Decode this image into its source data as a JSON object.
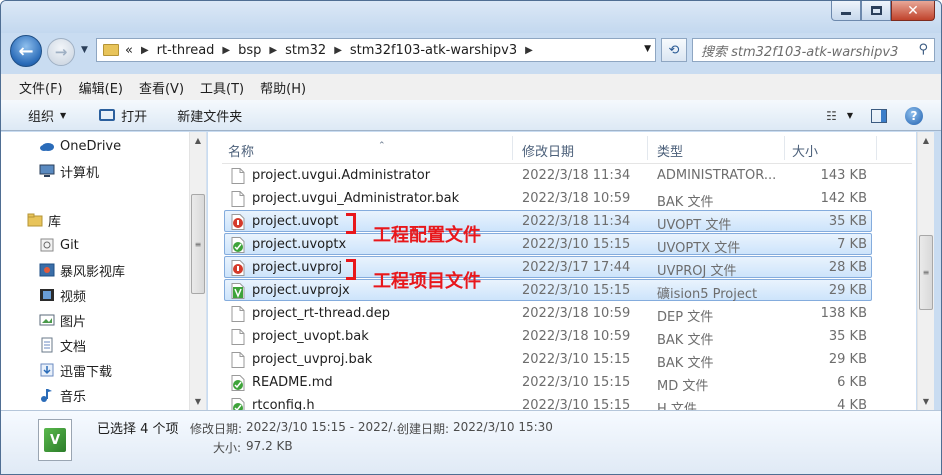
{
  "window": {
    "minimize": "–",
    "maximize": "□",
    "close": "✕"
  },
  "address": {
    "prefix": "«",
    "crumbs": [
      "rt-thread",
      "bsp",
      "stm32",
      "stm32f103-atk-warshipv3"
    ],
    "search_placeholder": "搜索 stm32f103-atk-warshipv3"
  },
  "menu": [
    "文件(F)",
    "编辑(E)",
    "查看(V)",
    "工具(T)",
    "帮助(H)"
  ],
  "toolbar": {
    "organize": "组织",
    "open": "打开",
    "new_folder": "新建文件夹"
  },
  "nav": [
    {
      "label": "OneDrive",
      "icon": "cloud-icon"
    },
    {
      "label": "计算机",
      "icon": "computer-icon"
    },
    {
      "label": "库",
      "icon": "library-icon"
    },
    {
      "label": "Git",
      "icon": "git-icon"
    },
    {
      "label": "暴风影视库",
      "icon": "video-library-icon"
    },
    {
      "label": "视频",
      "icon": "video-icon"
    },
    {
      "label": "图片",
      "icon": "picture-icon"
    },
    {
      "label": "文档",
      "icon": "document-icon"
    },
    {
      "label": "迅雷下载",
      "icon": "download-icon"
    },
    {
      "label": "音乐",
      "icon": "music-icon"
    }
  ],
  "columns": {
    "name": "名称",
    "date": "修改日期",
    "type": "类型",
    "size": "大小"
  },
  "files": [
    {
      "name": "project.uvgui.Administrator",
      "date": "2022/3/18 11:34",
      "type": "ADMINISTRATOR...",
      "size": "143 KB",
      "icon": "file-icon",
      "selected": false
    },
    {
      "name": "project.uvgui_Administrator.bak",
      "date": "2022/3/18 10:59",
      "type": "BAK 文件",
      "size": "142 KB",
      "icon": "file-icon",
      "selected": false
    },
    {
      "name": "project.uvopt",
      "date": "2022/3/18 11:34",
      "type": "UVOPT 文件",
      "size": "35 KB",
      "icon": "keil-red-icon",
      "selected": true
    },
    {
      "name": "project.uvoptx",
      "date": "2022/3/10 15:15",
      "type": "UVOPTX 文件",
      "size": "7 KB",
      "icon": "keil-green-icon",
      "selected": true
    },
    {
      "name": "project.uvproj",
      "date": "2022/3/17 17:44",
      "type": "UVPROJ 文件",
      "size": "28 KB",
      "icon": "keil-red-icon",
      "selected": true
    },
    {
      "name": "project.uvprojx",
      "date": "2022/3/10 15:15",
      "type": "礦ision5 Project",
      "size": "29 KB",
      "icon": "keil-project-icon",
      "selected": true
    },
    {
      "name": "project_rt-thread.dep",
      "date": "2022/3/18 10:59",
      "type": "DEP 文件",
      "size": "138 KB",
      "icon": "file-icon",
      "selected": false
    },
    {
      "name": "project_uvopt.bak",
      "date": "2022/3/18 10:59",
      "type": "BAK 文件",
      "size": "35 KB",
      "icon": "file-icon",
      "selected": false
    },
    {
      "name": "project_uvproj.bak",
      "date": "2022/3/10 15:15",
      "type": "BAK 文件",
      "size": "29 KB",
      "icon": "file-icon",
      "selected": false
    },
    {
      "name": "README.md",
      "date": "2022/3/10 15:15",
      "type": "MD 文件",
      "size": "6 KB",
      "icon": "keil-green-icon",
      "selected": false
    },
    {
      "name": "rtconfig.h",
      "date": "2022/3/10 15:15",
      "type": "H 文件",
      "size": "4 KB",
      "icon": "keil-green-icon",
      "selected": false
    }
  ],
  "annotations": {
    "config": "工程配置文件",
    "project": "工程项目文件"
  },
  "status": {
    "selected": "已选择 4 个项",
    "modified_label": "修改日期:",
    "modified_value": "2022/3/10 15:15 - 2022/...",
    "created_label": "创建日期:",
    "created_value": "2022/3/10 15:30",
    "size_label": "大小:",
    "size_value": "97.2 KB"
  },
  "colors": {
    "selection": "#cde4fb",
    "annotation": "#e8171b",
    "accent": "#2a6bb8"
  }
}
